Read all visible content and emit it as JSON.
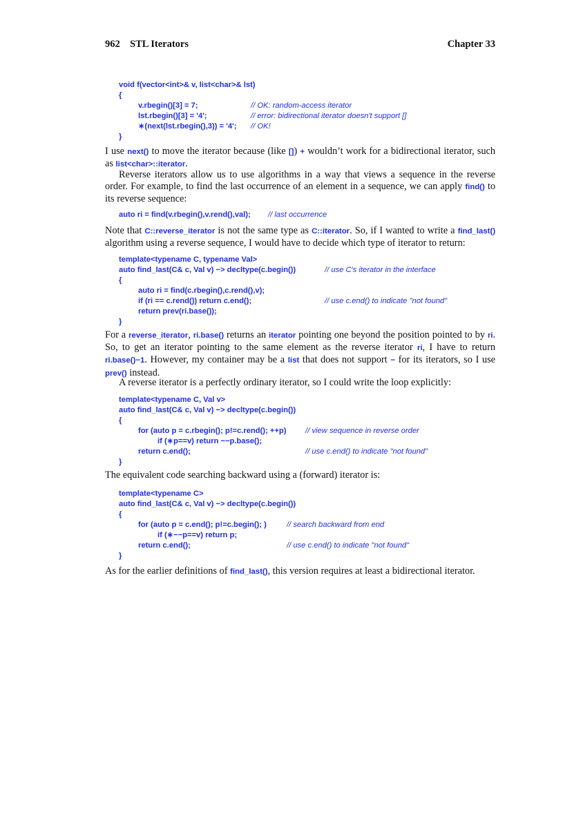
{
  "header": {
    "page_number": "962",
    "section_title": "STL Iterators",
    "chapter": "Chapter 33"
  },
  "code1": {
    "lines": [
      "void f(vector<int>& v, list<char>& lst)",
      "{",
      "v.rbegin()[3] = 7;",
      "lst.rbegin()[3] = '4';",
      "∗(next(lst.rbegin(),3)) = '4';",
      "}"
    ],
    "comments": [
      "// OK: random-access iterator",
      "// error: bidirectional iterator doesn't support []",
      "// OK!"
    ]
  },
  "p1": {
    "t1": "I use ",
    "k1": "next()",
    "t2": " to move the iterator because (like ",
    "k2": "[]",
    "t3": ") ",
    "k3": "+",
    "t4": " wouldn’t work for a bidirectional iterator, such as ",
    "k4": "list<char>::iterator",
    "t5": "."
  },
  "p2": {
    "t1": "Reverse iterators allow us to use algorithms in a way that views a sequence in the reverse order. For example, to find the last occurrence of an element in a sequence, we can apply ",
    "k1": "find()",
    "t2": " to its reverse sequence:"
  },
  "code2": {
    "line": "auto ri = find(v.rbegin(),v.rend(),val);",
    "comment": "// last occurrence"
  },
  "p3": {
    "t1": "Note that ",
    "k1": "C::reverse_iterator",
    "t2": " is not the same type as ",
    "k2": "C::iterator",
    "t3": ".  So, if I wanted to write a ",
    "k3": "find_last()",
    "t4": " algorithm using a reverse sequence, I would have to decide which type of iterator to return:"
  },
  "code3": {
    "lines": [
      "template<typename C, typename Val>",
      "auto find_last(C& c, Val v) −> decltype(c.begin())",
      "{",
      "auto ri = find(c.rbegin(),c.rend(),v);",
      "if (ri == c.rend()) return c.end();",
      "return prev(ri.base());",
      "}"
    ],
    "comments": [
      "// use C's iterator in the interface",
      "// use c.end() to indicate \"not found\""
    ]
  },
  "p4": {
    "t1": "For a ",
    "k1": "reverse_iterator",
    "t2": ", ",
    "k2": "ri.base()",
    "t3": " returns an ",
    "k3": "iterator",
    "t4": " pointing one beyond the position pointed to by ",
    "k4": "ri",
    "t5": ". So, to get an iterator pointing to the same element as the reverse iterator ",
    "k5": "ri",
    "t6": ", I have to return ",
    "k6": "ri.base()−1",
    "t7": ".  However, my container may be a ",
    "k7": "list",
    "t8": " that does not support ",
    "k8": "−",
    "t9": " for its iterators, so I use ",
    "k9": "prev()",
    "t10": " instead."
  },
  "p5": {
    "text": "A reverse iterator is a perfectly ordinary iterator, so I could write the loop explicitly:"
  },
  "code4": {
    "lines": [
      "template<typename C, Val v>",
      "auto find_last(C& c, Val v) −> decltype(c.begin())",
      "{",
      "for (auto p = c.rbegin(); p!=c.rend(); ++p)",
      "if (∗p==v) return −−p.base();",
      "return c.end();",
      "}"
    ],
    "comments": [
      "// view sequence in reverse order",
      "// use c.end() to indicate \"not found\""
    ]
  },
  "p6": {
    "text": "The equivalent code searching backward using a (forward) iterator is:"
  },
  "code5": {
    "lines": [
      "template<typename C>",
      "auto find_last(C& c, Val v) −> decltype(c.begin())",
      "{",
      "for (auto p = c.end(); p!=c.begin(); )",
      "if (∗−−p==v) return p;",
      "return c.end();",
      "}"
    ],
    "comments": [
      "// search backward from end",
      "// use c.end() to indicate \"not found\""
    ]
  },
  "p7": {
    "t1": "As for the earlier definitions of ",
    "k1": "find_last()",
    "t2": ", this version requires at least a bidirectional iterator."
  }
}
